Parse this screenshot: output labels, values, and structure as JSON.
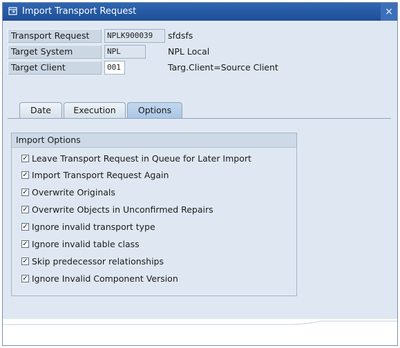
{
  "window": {
    "title": "Import Transport Request",
    "close_glyph": "×",
    "title_icon": "import-request-icon",
    "close_icon": "close-icon"
  },
  "fields": [
    {
      "label": "Transport Request",
      "value": "NPLK900039",
      "description": "sfdsfs"
    },
    {
      "label": "Target System",
      "value": "NPL",
      "description": "NPL Local"
    },
    {
      "label": "Target Client",
      "value": "001",
      "description": "Targ.Client=Source Client"
    }
  ],
  "tabs": [
    {
      "label": "Date"
    },
    {
      "label": "Execution"
    },
    {
      "label": "Options",
      "active": true
    }
  ],
  "import_options": {
    "title": "Import Options",
    "check_glyph": "✓",
    "items": [
      {
        "label": "Leave Transport Request in Queue for Later Import",
        "checked": true
      },
      {
        "label": "Import Transport Request Again",
        "checked": true
      },
      {
        "label": "Overwrite Originals",
        "checked": true
      },
      {
        "label": "Overwrite Objects in Unconfirmed Repairs",
        "checked": true
      },
      {
        "label": "Ignore invalid transport type",
        "checked": true
      },
      {
        "label": "Ignore invalid table class",
        "checked": true
      },
      {
        "label": "Skip predecessor relationships",
        "checked": true
      },
      {
        "label": "Ignore Invalid Component Version",
        "checked": true
      }
    ]
  },
  "colors": {
    "titlebar": "#2f66b3",
    "panel": "#dfe8f2",
    "active_tab": "#b5cfeb"
  }
}
